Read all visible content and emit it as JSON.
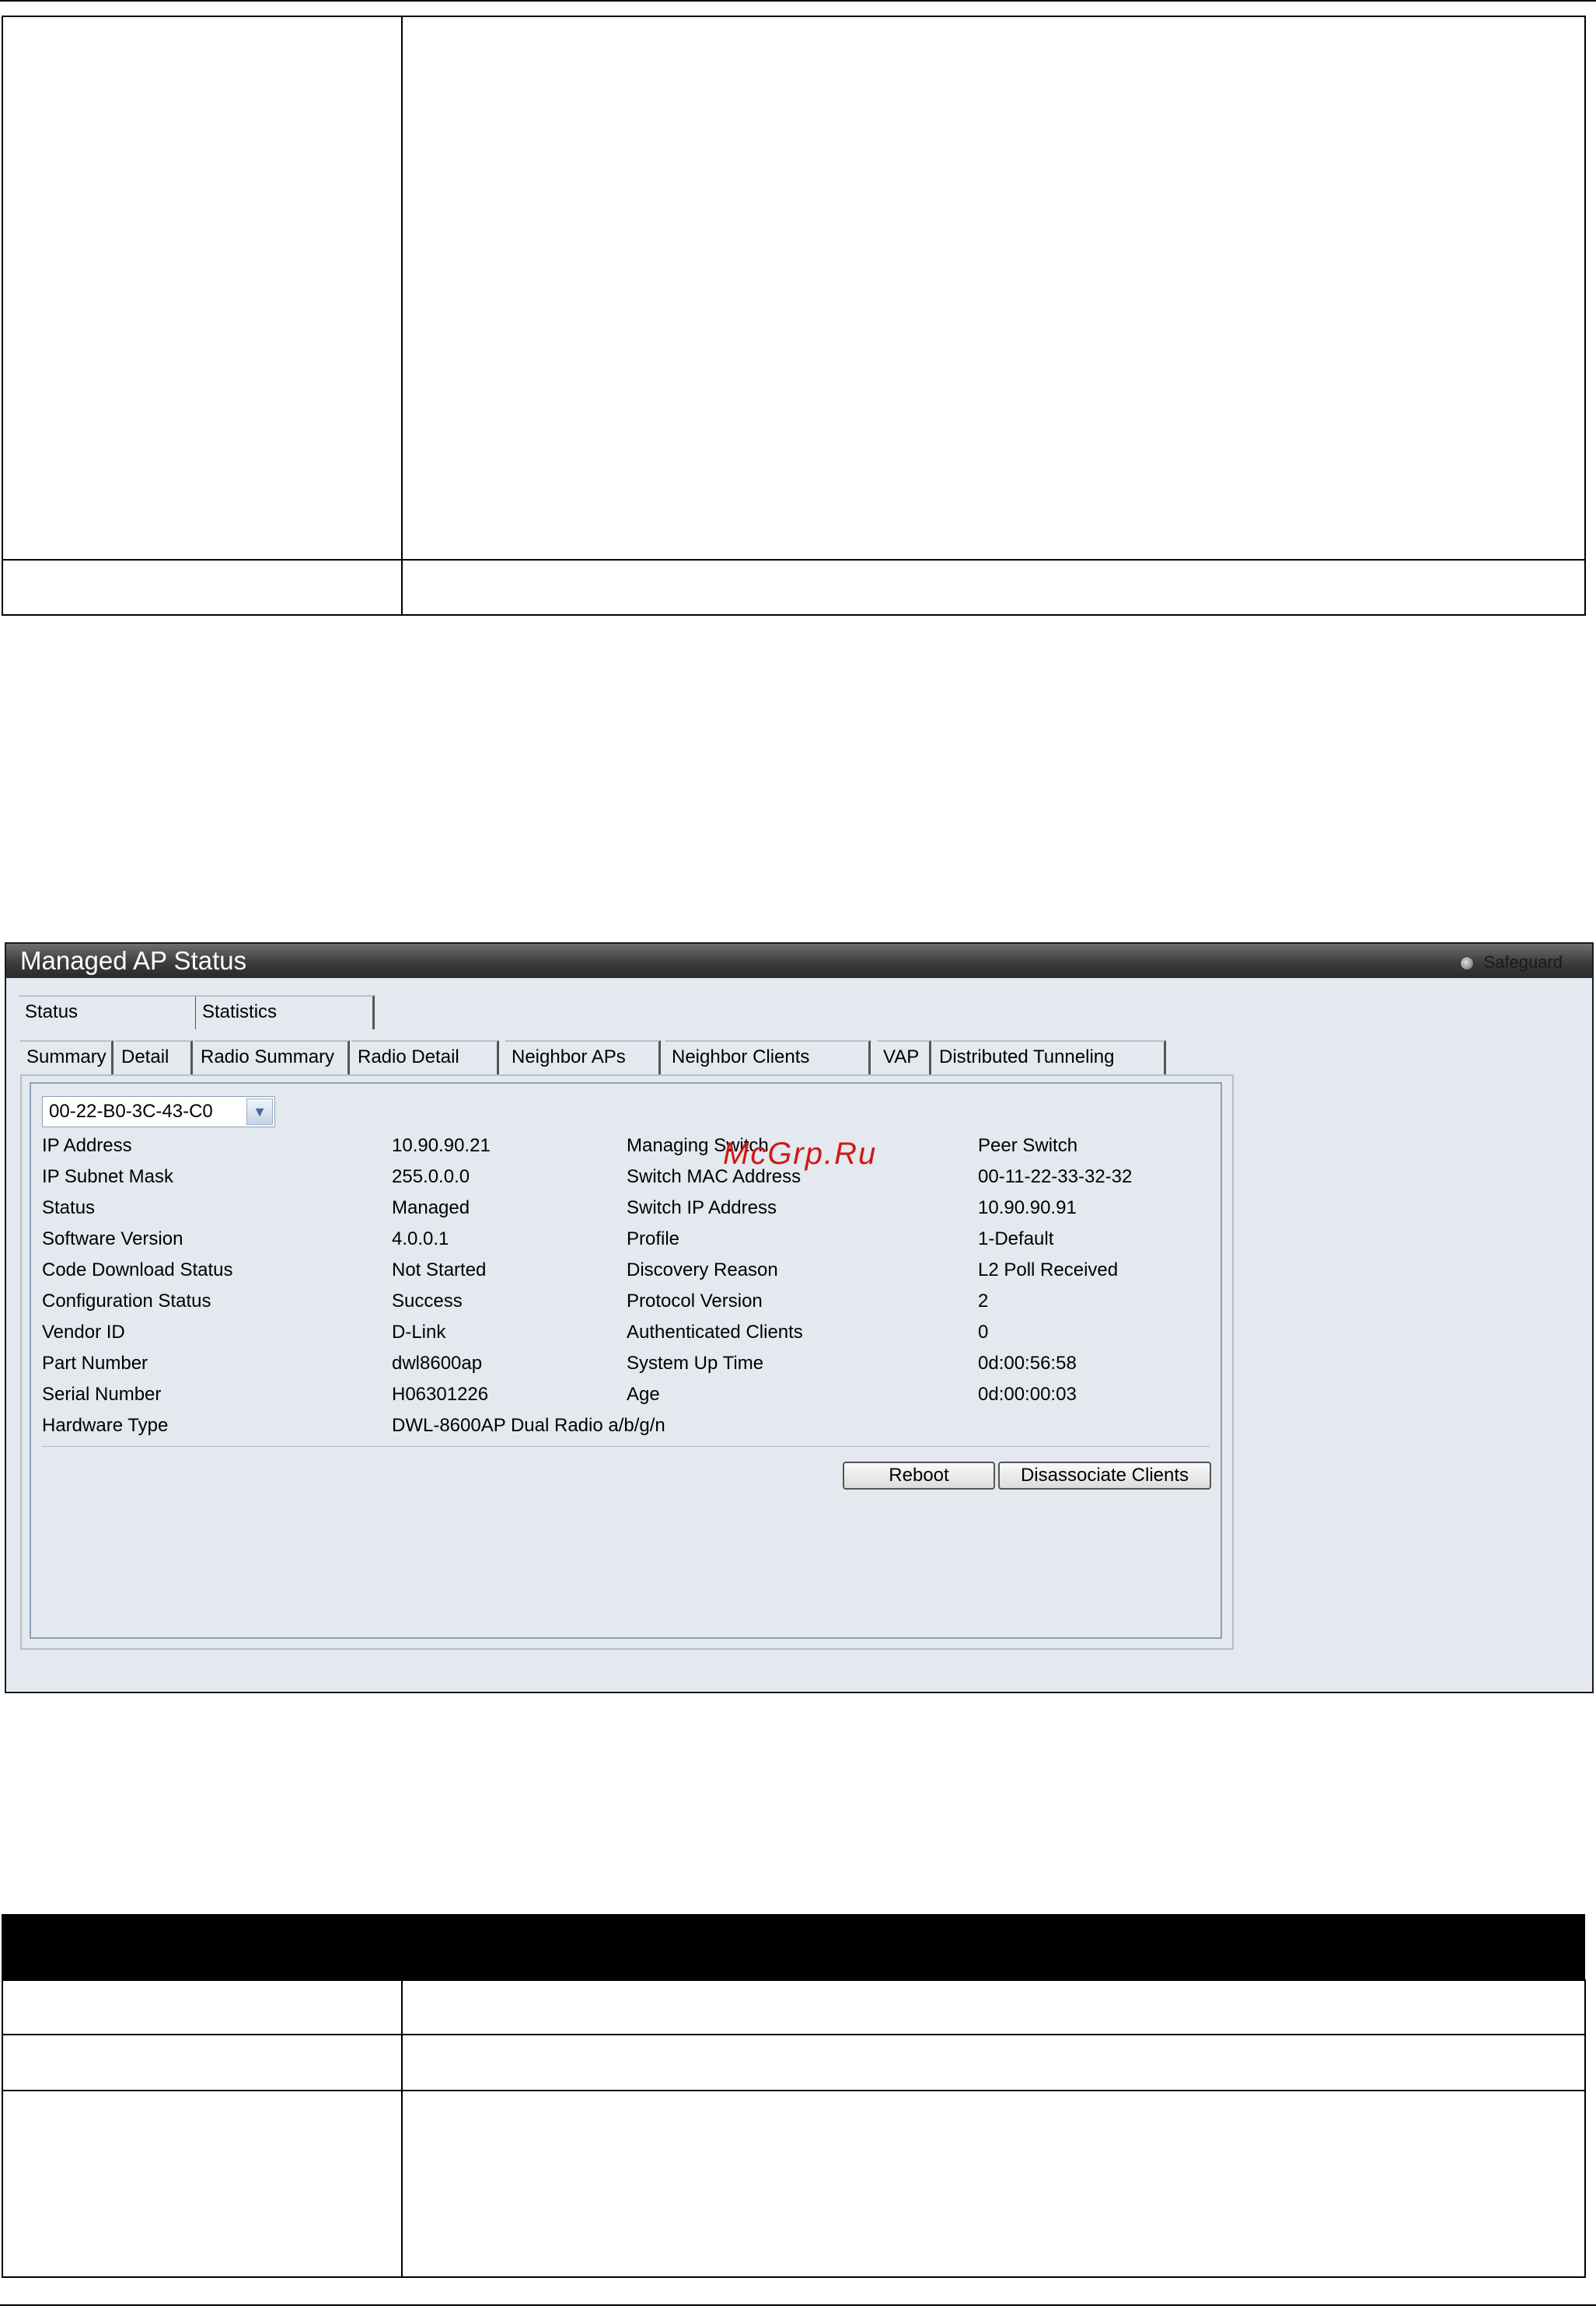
{
  "watermark": "McGrp.Ru",
  "window": {
    "title": "Managed AP Status",
    "safeguard_label": "Safeguard"
  },
  "tabs_primary": [
    {
      "label": "Status"
    },
    {
      "label": "Statistics"
    }
  ],
  "tabs_secondary": [
    {
      "label": "Summary"
    },
    {
      "label": "Detail"
    },
    {
      "label": "Radio Summary"
    },
    {
      "label": "Radio Detail"
    },
    {
      "label": "Neighbor APs"
    },
    {
      "label": "Neighbor Clients"
    },
    {
      "label": "VAP"
    },
    {
      "label": "Distributed Tunneling"
    }
  ],
  "ap_select": {
    "value": "00-22-B0-3C-43-C0"
  },
  "details_left": [
    {
      "label": "IP Address",
      "value": "10.90.90.21"
    },
    {
      "label": "IP Subnet Mask",
      "value": "255.0.0.0"
    },
    {
      "label": "Status",
      "value": "Managed"
    },
    {
      "label": "Software Version",
      "value": "4.0.0.1"
    },
    {
      "label": "Code Download Status",
      "value": "Not Started"
    },
    {
      "label": "Configuration Status",
      "value": "Success"
    },
    {
      "label": "Vendor ID",
      "value": "D-Link"
    },
    {
      "label": "Part Number",
      "value": "dwl8600ap"
    },
    {
      "label": "Serial Number",
      "value": "H06301226"
    },
    {
      "label": "Hardware Type",
      "value": "DWL-8600AP Dual Radio a/b/g/n"
    }
  ],
  "details_right": [
    {
      "label": "Managing Switch",
      "value": "Peer Switch"
    },
    {
      "label": "Switch MAC Address",
      "value": "00-11-22-33-32-32"
    },
    {
      "label": "Switch IP Address",
      "value": "10.90.90.91"
    },
    {
      "label": "Profile",
      "value": "1-Default"
    },
    {
      "label": "Discovery Reason",
      "value": "L2 Poll Received"
    },
    {
      "label": "Protocol Version",
      "value": "2"
    },
    {
      "label": "Authenticated Clients",
      "value": "0"
    },
    {
      "label": "System Up Time",
      "value": "0d:00:56:58"
    },
    {
      "label": "Age",
      "value": "0d:00:00:03"
    }
  ],
  "buttons": {
    "reboot": "Reboot",
    "disassociate": "Disassociate Clients"
  }
}
